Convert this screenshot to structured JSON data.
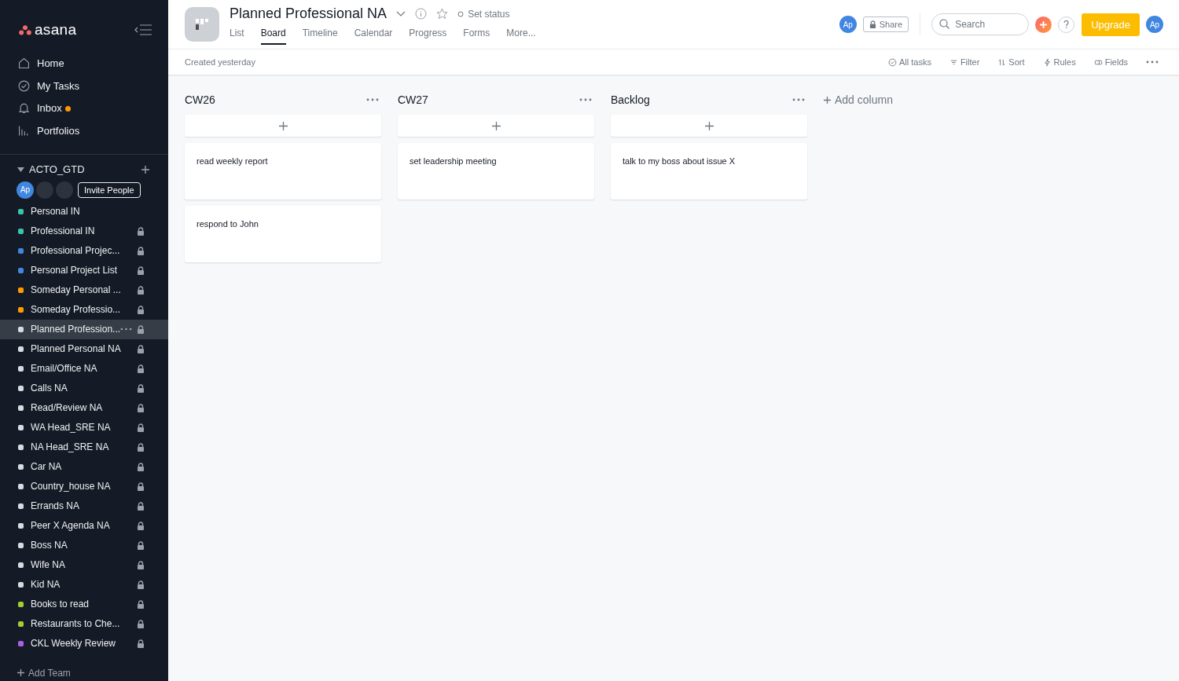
{
  "sidebar": {
    "logo_text": "asana",
    "nav": [
      {
        "label": "Home",
        "badge": false
      },
      {
        "label": "My Tasks",
        "badge": false
      },
      {
        "label": "Inbox",
        "badge": true
      },
      {
        "label": "Portfolios",
        "badge": false
      }
    ],
    "team": {
      "name": "ACTO_GTD",
      "expanded": true,
      "avatar": "Ap",
      "invite": "Invite People"
    },
    "projects": [
      {
        "name": "Personal IN",
        "color": "#37c5ab",
        "locked": false,
        "selected": false
      },
      {
        "name": "Professional IN",
        "color": "#37c5ab",
        "locked": true,
        "selected": false
      },
      {
        "name": "Professional Projec...",
        "color": "#4186e0",
        "locked": true,
        "selected": false
      },
      {
        "name": "Personal Project List",
        "color": "#4186e0",
        "locked": true,
        "selected": false
      },
      {
        "name": "Someday Personal ...",
        "color": "#fd9a00",
        "locked": true,
        "selected": false
      },
      {
        "name": "Someday Professio...",
        "color": "#fd9a00",
        "locked": true,
        "selected": false
      },
      {
        "name": "Planned Profession...",
        "color": "#d8dbe0",
        "locked": true,
        "selected": true
      },
      {
        "name": "Planned Personal NA",
        "color": "#d8dbe0",
        "locked": true,
        "selected": false
      },
      {
        "name": "Email/Office NA",
        "color": "#d8dbe0",
        "locked": true,
        "selected": false
      },
      {
        "name": "Calls NA",
        "color": "#d8dbe0",
        "locked": true,
        "selected": false
      },
      {
        "name": "Read/Review NA",
        "color": "#d8dbe0",
        "locked": true,
        "selected": false
      },
      {
        "name": "WA Head_SRE NA",
        "color": "#d8dbe0",
        "locked": true,
        "selected": false
      },
      {
        "name": "NA Head_SRE NA",
        "color": "#d8dbe0",
        "locked": true,
        "selected": false
      },
      {
        "name": "Car NA",
        "color": "#d8dbe0",
        "locked": true,
        "selected": false
      },
      {
        "name": "Country_house NA",
        "color": "#d8dbe0",
        "locked": true,
        "selected": false
      },
      {
        "name": "Errands NA",
        "color": "#d8dbe0",
        "locked": true,
        "selected": false
      },
      {
        "name": "Peer X Agenda NA",
        "color": "#d8dbe0",
        "locked": true,
        "selected": false
      },
      {
        "name": "Boss NA",
        "color": "#d8dbe0",
        "locked": true,
        "selected": false
      },
      {
        "name": "Wife NA",
        "color": "#d8dbe0",
        "locked": true,
        "selected": false
      },
      {
        "name": "Kid NA",
        "color": "#d8dbe0",
        "locked": true,
        "selected": false
      },
      {
        "name": "Books to read",
        "color": "#a4cf30",
        "locked": true,
        "selected": false
      },
      {
        "name": "Restaurants to Che...",
        "color": "#a4cf30",
        "locked": true,
        "selected": false
      },
      {
        "name": "CKL Weekly Review",
        "color": "#aa62e3",
        "locked": true,
        "selected": false
      }
    ],
    "add_team": "Add Team"
  },
  "header": {
    "title": "Planned Professional NA",
    "set_status": "Set status",
    "tabs": [
      {
        "label": "List",
        "selected": false
      },
      {
        "label": "Board",
        "selected": true
      },
      {
        "label": "Timeline",
        "selected": false
      },
      {
        "label": "Calendar",
        "selected": false
      },
      {
        "label": "Progress",
        "selected": false
      },
      {
        "label": "Forms",
        "selected": false
      },
      {
        "label": "More...",
        "selected": false
      }
    ],
    "member_avatar": "Ap",
    "share": "Share",
    "search": {
      "placeholder": "Search"
    },
    "upgrade": "Upgrade",
    "user_avatar": "Ap"
  },
  "toolbar": {
    "created": "Created yesterday",
    "actions": [
      {
        "label": "All tasks"
      },
      {
        "label": "Filter"
      },
      {
        "label": "Sort"
      },
      {
        "label": "Rules"
      },
      {
        "label": "Fields"
      }
    ]
  },
  "board": {
    "columns": [
      {
        "title": "CW26",
        "cards": [
          "read weekly report",
          "respond to John"
        ]
      },
      {
        "title": "CW27",
        "cards": [
          "set leadership meeting"
        ]
      },
      {
        "title": "Backlog",
        "cards": [
          "talk to my boss about issue X"
        ]
      }
    ],
    "add_column": "Add column"
  }
}
